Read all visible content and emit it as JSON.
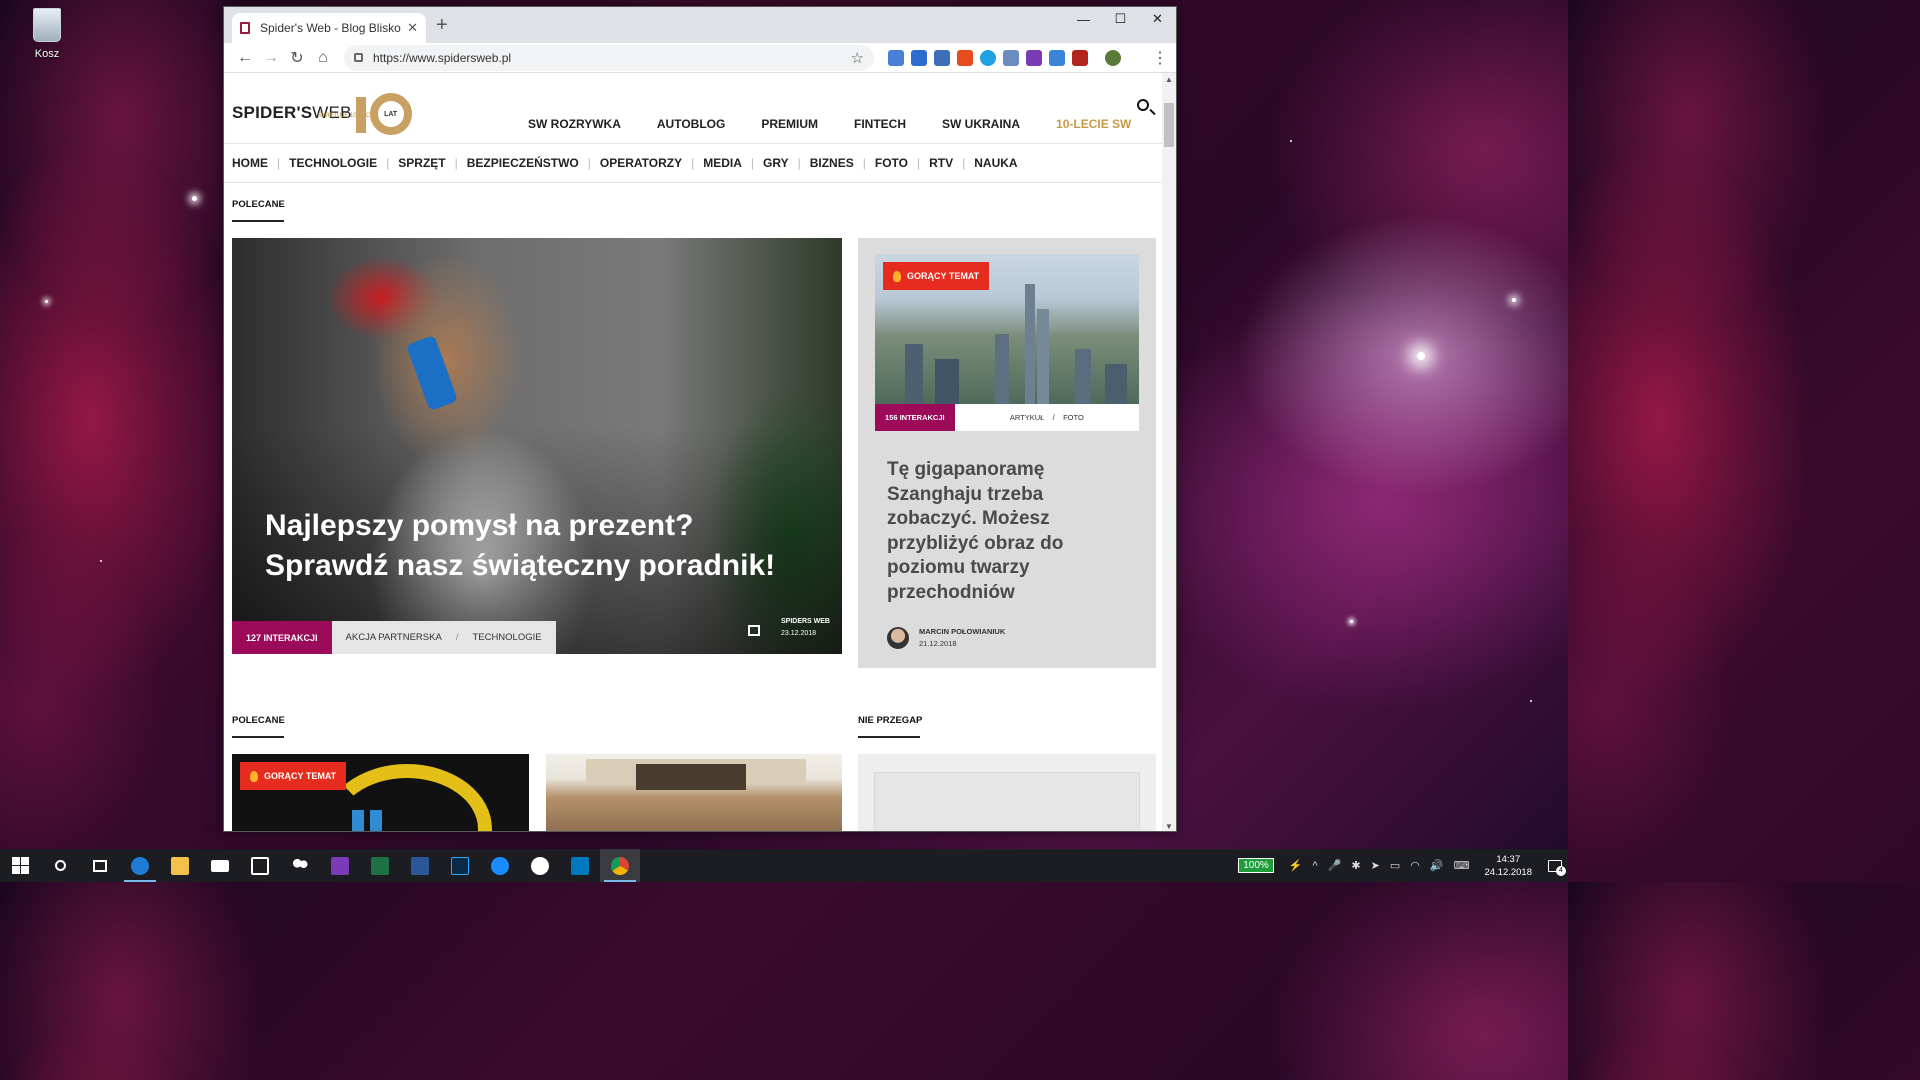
{
  "desktop": {
    "recycle_bin_label": "Kosz"
  },
  "browser": {
    "tab_title": "Spider's Web - Blog Blisko Techn",
    "url": "https://www.spidersweb.pl"
  },
  "site": {
    "logo_main": "SPIDER'S",
    "logo_web": "WEB",
    "logo_sub": "ŚWIĘTUJE 10 LECIE",
    "logo_badge": "LAT",
    "top_nav": [
      "SW ROZRYWKA",
      "AUTOBLOG",
      "PREMIUM",
      "FINTECH",
      "SW UKRAINA",
      "10-LECIE SW"
    ],
    "accent_color": "#c79a45",
    "category_nav": [
      "HOME",
      "TECHNOLOGIE",
      "SPRZĘT",
      "BEZPIECZEŃSTWO",
      "OPERATORZY",
      "MEDIA",
      "GRY",
      "BIZNES",
      "FOTO",
      "RTV",
      "NAUKA"
    ]
  },
  "section_polecane": "POLECANE",
  "hero": {
    "title": "Najlepszy pomysł na prezent? Sprawdź nasz świąteczny poradnik!",
    "interactions": "127 INTERAKCJI",
    "category1": "AKCJA PARTNERSKA",
    "separator": "/",
    "category2": "TECHNOLOGIE",
    "author": "SPIDERS WEB",
    "date": "23.12.2018"
  },
  "side_article": {
    "badge": "GORĄCY TEMAT",
    "interactions": "156 INTERAKCJI",
    "category1": "ARTYKUŁ",
    "separator": "/",
    "category2": "FOTO",
    "title": "Tę gigapanoramę Szanghaju trzeba zobaczyć. Możesz przybliżyć obraz do poziomu twarzy przechodniów",
    "author": "MARCIN POŁOWIANIUK",
    "date": "21.12.2018"
  },
  "section_polecane_2": "POLECANE",
  "section_nie_przegap": "NIE PRZEGAP",
  "card1_badge": "GORĄCY TEMAT",
  "interaction_color": "#9c0a5a",
  "hot_color": "#e62c1e",
  "taskbar": {
    "battery": "100%",
    "time": "14:37",
    "date": "24.12.2018",
    "notifications": "4"
  }
}
